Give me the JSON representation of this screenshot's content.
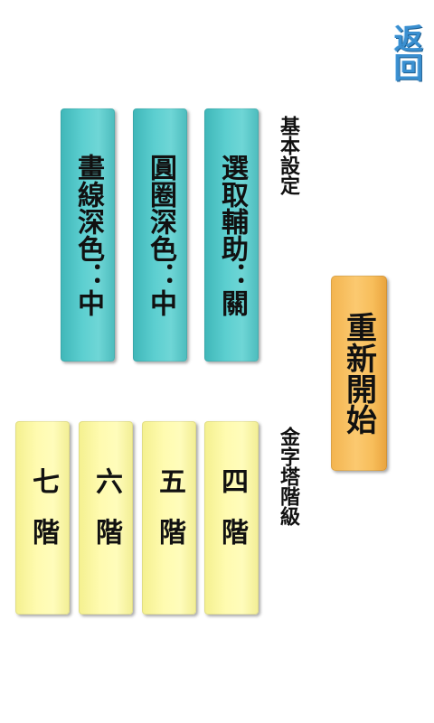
{
  "header": {
    "back_label": "返回"
  },
  "basic_settings": {
    "title": "基本設定",
    "items": [
      {
        "label": "選取輔助：關"
      },
      {
        "label": "圓圈深色：中"
      },
      {
        "label": "畫線深色：中"
      }
    ]
  },
  "pyramid_levels": {
    "title": "金字塔階級",
    "items": [
      {
        "label": "四階"
      },
      {
        "label": "五階"
      },
      {
        "label": "六階"
      },
      {
        "label": "七階"
      }
    ]
  },
  "actions": {
    "restart_label": "重新開始"
  },
  "colors": {
    "back_text": "#3a8fd0",
    "setting_button": "#5ccfd0",
    "level_button": "#fffbb0",
    "restart_button": "#fbc970"
  }
}
